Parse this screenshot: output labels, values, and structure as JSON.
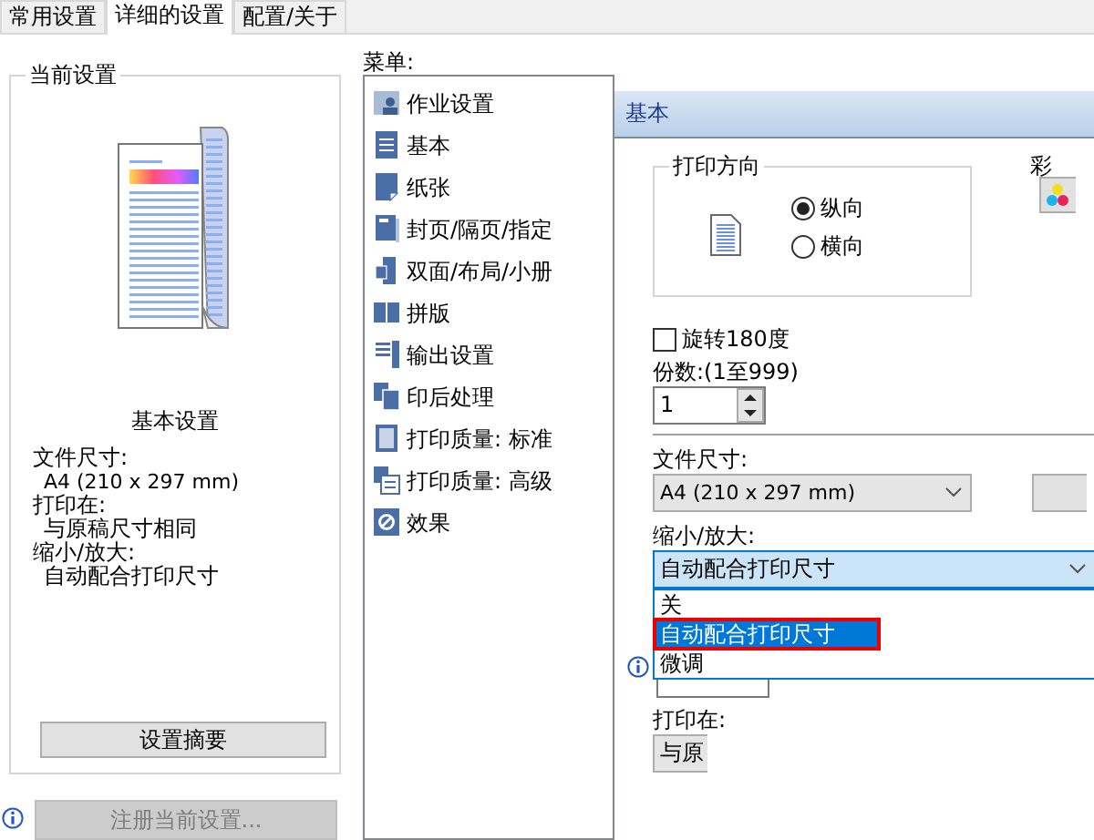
{
  "tabs": [
    {
      "label": "常用设置",
      "selected": false
    },
    {
      "label": "详细的设置",
      "selected": true
    },
    {
      "label": "配置/关于",
      "selected": false
    }
  ],
  "current_settings": {
    "title": "当前设置",
    "heading": "基本设置",
    "lines": [
      "文件尺寸:",
      "A4 (210 x 297 mm)",
      "打印在:",
      "与原稿尺寸相同",
      "缩小/放大:",
      "自动配合打印尺寸"
    ],
    "summary_button": "设置摘要"
  },
  "register_button": {
    "label": "注册当前设置...",
    "disabled": true
  },
  "menu": {
    "label": "菜单:",
    "items": [
      {
        "label": "作业设置",
        "selected": false
      },
      {
        "label": "基本",
        "selected": false
      },
      {
        "label": "纸张",
        "selected": false
      },
      {
        "label": "封页/隔页/指定",
        "selected": false
      },
      {
        "label": "双面/布局/小册",
        "selected": false
      },
      {
        "label": "拼版",
        "selected": false
      },
      {
        "label": "输出设置",
        "selected": false
      },
      {
        "label": "印后处理",
        "selected": false
      },
      {
        "label": "打印质量: 标准",
        "selected": false
      },
      {
        "label": "打印质量: 高级",
        "selected": false
      },
      {
        "label": "效果",
        "selected": false
      }
    ]
  },
  "panel": {
    "title": "基本",
    "orientation": {
      "title": "打印方向",
      "options": [
        {
          "label": "纵向",
          "selected": true
        },
        {
          "label": "横向",
          "selected": false
        }
      ]
    },
    "color_label": "彩",
    "rotate": {
      "label": "旋转180度",
      "checked": false
    },
    "copies": {
      "label": "份数:(1至999)",
      "value": "1"
    },
    "paper_size": {
      "label": "文件尺寸:",
      "value": "A4 (210 x 297 mm)"
    },
    "zoom": {
      "label": "缩小/放大:",
      "value": "自动配合打印尺寸",
      "expanded": true,
      "options": [
        {
          "label": "关",
          "selected": false,
          "annotated": false
        },
        {
          "label": "自动配合打印尺寸",
          "selected": true,
          "annotated": true
        },
        {
          "label": "微调",
          "selected": false,
          "annotated": false
        }
      ]
    },
    "print_on": {
      "label": "打印在:",
      "value": "与原"
    }
  }
}
